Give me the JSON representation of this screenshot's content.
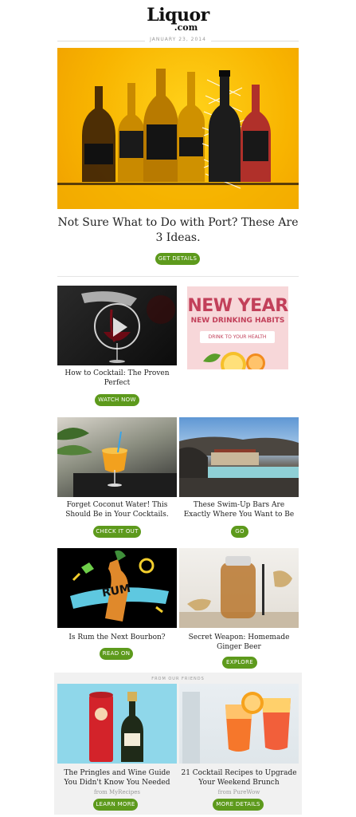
{
  "header": {
    "logo_line1": "Liquor",
    "logo_line2": ".com",
    "date": "JANUARY 23, 2014"
  },
  "hero": {
    "headline": "Not Sure What to Do with Port? These Are 3 Ideas.",
    "button": "GET DETAILS"
  },
  "rows": [
    {
      "left": {
        "caption": "How to Cocktail: The Proven Perfect",
        "button": "WATCH NOW"
      },
      "right": {
        "ad_line1": "NEW YEAR",
        "ad_line2": "NEW DRINKING HABITS",
        "ad_line3": "DRINK TO YOUR HEALTH"
      }
    },
    {
      "left": {
        "caption": "Forget Coconut Water! This Should Be in Your Cocktails.",
        "button": "CHECK IT OUT"
      },
      "right": {
        "caption": "These Swim-Up Bars Are Exactly Where You Want to Be",
        "button": "GO"
      }
    },
    {
      "left": {
        "caption": "Is Rum the Next Bourbon?",
        "button": "READ ON",
        "art_text": "RUM"
      },
      "right": {
        "caption": "Secret Weapon: Homemade Ginger Beer",
        "button": "EXPLORE"
      }
    }
  ],
  "friends": {
    "label": "FROM OUR FRIENDS",
    "left": {
      "caption": "The Pringles and Wine Guide You Didn't Know You Needed",
      "source": "from MyRecipes",
      "button": "LEARN MORE"
    },
    "right": {
      "caption": "21 Cocktail Recipes to Upgrade Your Weekend Brunch",
      "source": "from PureWow",
      "button": "MORE DETAILS"
    }
  },
  "colors": {
    "button_green": "#5d9a1c",
    "hero_yellow": "#f8b400",
    "ad_pink": "#f7d7d9",
    "ad_red": "#c2405a"
  }
}
